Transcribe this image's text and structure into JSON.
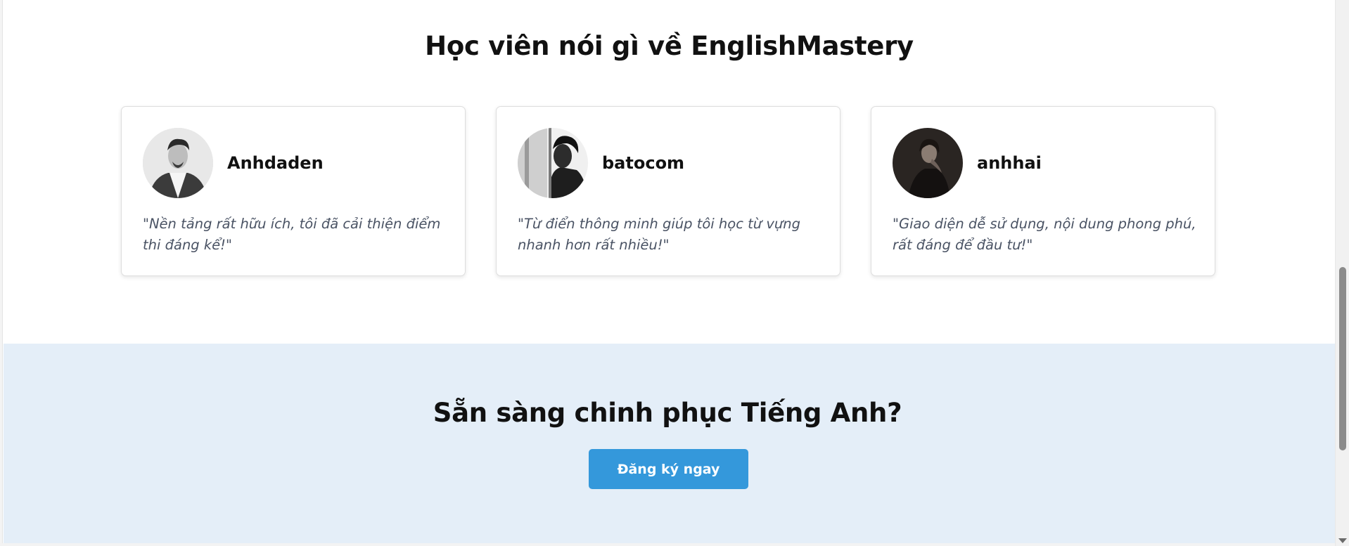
{
  "testimonials": {
    "title": "Học viên nói gì về EnglishMastery",
    "cards": [
      {
        "name": "Anhdaden",
        "quote": "\"Nền tảng rất hữu ích, tôi đã cải thiện điểm thi đáng kể!\""
      },
      {
        "name": "batocom",
        "quote": "\"Từ điển thông minh giúp tôi học từ vựng nhanh hơn rất nhiều!\""
      },
      {
        "name": "anhhai",
        "quote": "\"Giao diện dễ sử dụng, nội dung phong phú, rất đáng để đầu tư!\""
      }
    ]
  },
  "cta": {
    "title": "Sẵn sàng chinh phục Tiếng Anh?",
    "button_label": "Đăng ký ngay"
  },
  "colors": {
    "accent": "#3498db",
    "cta_background": "#e4eef8",
    "quote_text": "#4a5364"
  },
  "icons": {
    "scroll_down": "scroll-down-arrow-icon"
  }
}
